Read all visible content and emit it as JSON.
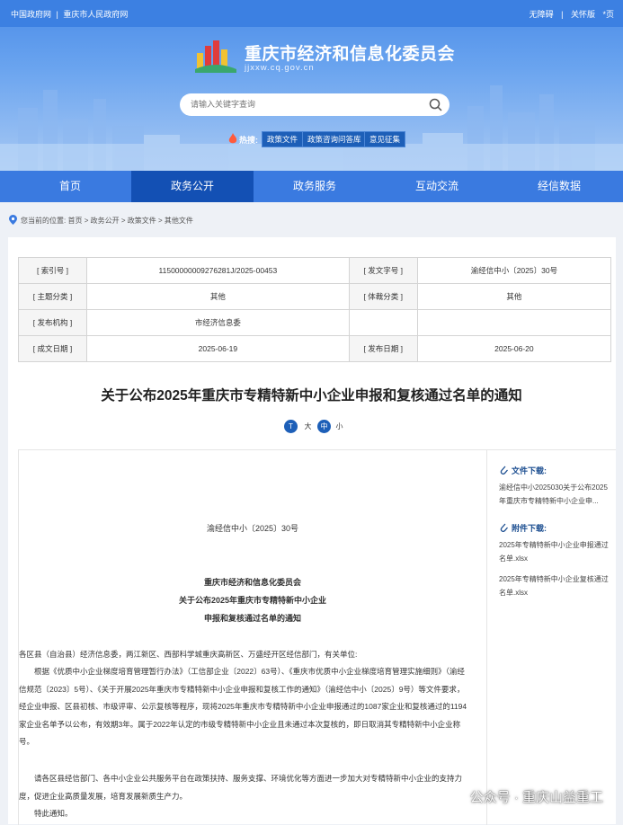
{
  "toplinks": {
    "left": [
      "中国政府网",
      "|",
      "重庆市人民政府网"
    ],
    "right": [
      "无障碍",
      "|",
      "关怀版",
      "*页"
    ]
  },
  "site": {
    "title": "重庆市经济和信息化委员会",
    "url": "jjxxw.cq.gov.cn"
  },
  "search": {
    "placeholder": "请输入关键字查询"
  },
  "hot": {
    "label": "热搜:",
    "tags": [
      "政策文件",
      "政策咨询问答库",
      "意见征集"
    ]
  },
  "nav": [
    "首页",
    "政务公开",
    "政务服务",
    "互动交流",
    "经信数据"
  ],
  "breadcrumb": [
    "您当前的位置:",
    "首页",
    ">",
    "政务公开",
    ">",
    "政策文件",
    ">",
    "其他文件"
  ],
  "meta": {
    "rows": [
      [
        "[ 索引号 ]",
        "11500000009276281J/2025-00453",
        "[ 发文字号 ]",
        "渝经信中小〔2025〕30号"
      ],
      [
        "[ 主题分类 ]",
        "其他",
        "[ 体裁分类 ]",
        "其他"
      ],
      [
        "[ 发布机构 ]",
        "市经济信息委",
        "",
        ""
      ],
      [
        "[ 成文日期 ]",
        "2025-06-19",
        "[ 发布日期 ]",
        "2025-06-20"
      ]
    ]
  },
  "doc_title": "关于公布2025年重庆市专精特新中小企业申报和复核通过名单的通知",
  "font_size": [
    "T",
    "大",
    "中",
    "小"
  ],
  "sidebar": {
    "file_header": "文件下载:",
    "file_link": "渝经信中小2025030关于公布2025年重庆市专精特新中小企业申...",
    "attach_header": "附件下载:",
    "attachments": [
      "2025年专精特新中小企业申报通过名单.xlsx",
      "2025年专精特新中小企业复核通过名单.xlsx"
    ]
  },
  "doc": {
    "number": "渝经信中小〔2025〕30号",
    "issuer": "重庆市经济和信息化委员会",
    "title_line1": "关于公布2025年重庆市专精特新中小企业",
    "title_line2": "申报和复核通过名单的通知",
    "salutation": "各区县（自治县）经济信息委，两江新区、西部科学城重庆高新区、万盛经开区经信部门，有关单位:",
    "para1": "根据《优质中小企业梯度培育管理暂行办法》（工信部企业〔2022〕63号）、《重庆市优质中小企业梯度培育管理实施细则》（渝经信规范〔2023〕5号）、《关于开展2025年重庆市专精特新中小企业申报和复核工作的通知》（渝经信中小〔2025〕9号）等文件要求，经企业申报、区县初核、市级评审、公示复核等程序，现将2025年重庆市专精特新中小企业申报通过的1087家企业和复核通过的1194家企业名单予以公布，有效期3年。属于2022年认定的市级专精特新中小企业且未通过本次复核的，即日取消其专精特新中小企业称号。",
    "para2": "请各区县经信部门、各中小企业公共服务平台在政策扶持、服务支撑、环境优化等方面进一步加大对专精特新中小企业的支持力度，促进企业高质量发展，培育发展新质生产力。",
    "closing": "特此通知。"
  },
  "watermark": "公众号 · 重庆山益重工"
}
